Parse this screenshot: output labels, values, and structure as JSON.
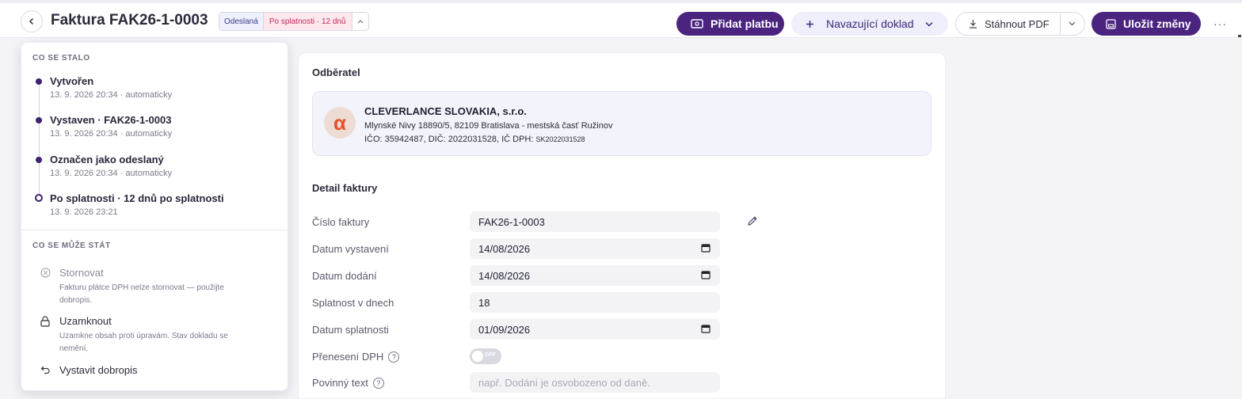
{
  "header": {
    "title": "Faktura FAK26-1-0003",
    "status_sent": "Odeslaná",
    "status_overdue": "Po splatnosti · 12 dnů",
    "btn_add_payment": "Přidat platbu",
    "btn_followup": "Navazující doklad",
    "btn_download_pdf": "Stáhnout PDF",
    "btn_save": "Uložit změny",
    "more": "···"
  },
  "history": {
    "heading": "CO SE STALO",
    "events": [
      {
        "title": "Vytvořen",
        "meta": "13. 9. 2026 20:34 · automaticky"
      },
      {
        "title": "Vystaven · FAK26-1-0003",
        "meta": "13. 9. 2026 20:34 · automaticky"
      },
      {
        "title": "Označen jako odeslaný",
        "meta": "13. 9. 2026 20:34 · automaticky"
      },
      {
        "title": "Po splatnosti · 12 dnů po splatnosti",
        "meta": "13. 9. 2026 23:21"
      }
    ]
  },
  "actions": {
    "heading": "CO SE MŮŽE STÁT",
    "items": [
      {
        "title": "Stornovat",
        "desc": "Fakturu plátce DPH nelze stornovat — použijte dobropis."
      },
      {
        "title": "Uzamknout",
        "desc": "Uzamkne obsah proti úpravám. Stav dokladu se nemění."
      },
      {
        "title": "Vystavit dobropis"
      }
    ]
  },
  "customer": {
    "heading": "Odběratel",
    "logo_letter": "α",
    "name": "CLEVERLANCE SLOVAKIA, s.r.o.",
    "address": "Mlynské Nivy 18890/5, 82109 Bratislava - mestská časť Ružinov",
    "ids": "IČO: 35942487, DIČ: 2022031528, IČ DPH:",
    "vat_id": "SK2022031528"
  },
  "invoice": {
    "heading": "Detail faktury",
    "number_label": "Číslo faktury",
    "number_value": "FAK26-1-0003",
    "issue_label": "Datum vystavení",
    "issue_value": "14/08/2026",
    "delivery_label": "Datum dodání",
    "delivery_value": "14/08/2026",
    "due_days_label": "Splatnost v dnech",
    "due_days_value": "18",
    "due_date_label": "Datum splatnosti",
    "due_date_value": "01/09/2026",
    "reverse_vat_label": "Přenesení DPH",
    "reverse_vat_state": "OFF",
    "mandatory_text_label": "Povinný text",
    "mandatory_text_placeholder": "např. Dodání je osvobozeno od daně.",
    "help_glyph": "?"
  },
  "colors": {
    "primary": "#4b2480",
    "overdue": "#c02a58",
    "customer_logo": "#e8502a"
  }
}
